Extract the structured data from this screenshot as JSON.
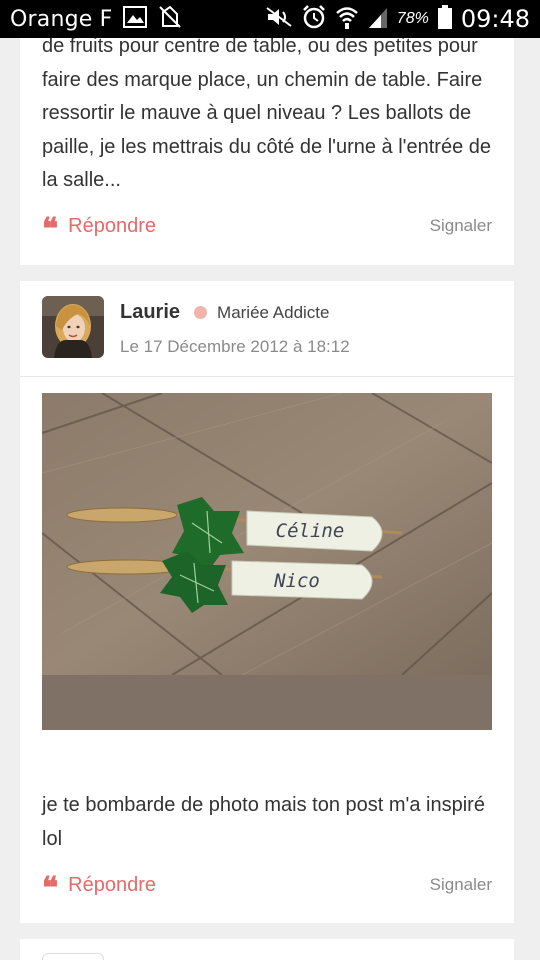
{
  "status_bar": {
    "carrier": "Orange F",
    "battery_percent": "78%",
    "time": "09:48",
    "icons": [
      "image-icon",
      "no-sim-icon",
      "mute-icon",
      "alarm-icon",
      "wifi-icon",
      "signal-icon",
      "battery-icon"
    ]
  },
  "post1": {
    "text": "de fruits pour centre de table, ou des petites pour faire des marque place, un chemin de table. Faire ressortir le mauve à quel niveau ? Les ballots de paille, je les mettrais du côté de l'urne à l'entrée de la salle...",
    "reply_label": "Répondre",
    "report_label": "Signaler"
  },
  "post2": {
    "author": "Laurie",
    "role": "Mariée Addicte",
    "date": "Le 17 Décembre 2012 à 18:12",
    "image_names": [
      "Céline",
      "Nico"
    ],
    "text": "je te bombarde de photo mais ton post m'a inspiré lol",
    "reply_label": "Répondre",
    "report_label": "Signaler"
  },
  "colors": {
    "accent": "#e56a6a",
    "role_dot": "#f0b4ad",
    "muted": "#8a8a8a",
    "background": "#efefef"
  }
}
